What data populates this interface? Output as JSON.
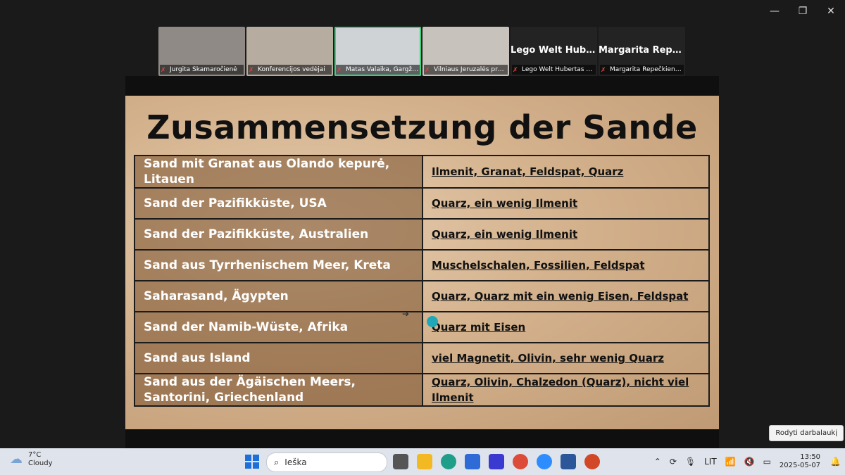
{
  "window": {
    "minimize": "—",
    "restore": "❐",
    "close": "✕"
  },
  "participants": [
    {
      "label": "Jurgita Skamaročienė",
      "bg": "#8f8a86",
      "active": false
    },
    {
      "label": "Konferencijos vedėjai",
      "bg": "#b7aca0",
      "active": false
    },
    {
      "label": "Matas Valaika, Gargždų \"K...",
      "bg": "#cfd3d6",
      "active": true
    },
    {
      "label": "Vilniaus Jeruzalės prog...",
      "bg": "#c7c2bb",
      "active": false
    },
    {
      "label": "Lego Welt Hubertas un...",
      "name": "Lego Welt Hube...",
      "bg": "#232323",
      "active": false
    },
    {
      "label": "Margarita Repečkienė, ...",
      "name": "Margarita Repe...",
      "bg": "#232323",
      "active": false
    }
  ],
  "slide": {
    "title": "Zusammensetzung der Sande",
    "rows": [
      {
        "name": "Sand mit Granat aus Olando kepurė, Litauen",
        "composition": "Ilmenit, Granat, Feldspat, Quarz"
      },
      {
        "name": "Sand der Pazifikküste, USA",
        "composition": "Quarz, ein wenig Ilmenit"
      },
      {
        "name": "Sand der Pazifikküste, Australien",
        "composition": "Quarz, ein wenig Ilmenit"
      },
      {
        "name": "Sand aus Tyrrhenischem Meer, Kreta",
        "composition": "Muschelschalen, Fossilien, Feldspat"
      },
      {
        "name": "Saharasand, Ägypten",
        "composition": "Quarz, Quarz mit ein wenig Eisen, Feldspat"
      },
      {
        "name": "Sand der Namib-Wüste, Afrika",
        "composition": "Quarz mit Eisen"
      },
      {
        "name": "Sand aus Island",
        "composition": "viel Magnetit, Olivin, sehr wenig Quarz"
      },
      {
        "name": "Sand aus der Ägäischen Meers, Santorini, Griechenland",
        "composition": "Quarz, Olivin, Chalzedon (Quarz), nicht viel Ilmenit"
      }
    ]
  },
  "tooltip": "Rodyti darbalaukį",
  "taskbar": {
    "weather_temp": "7°C",
    "weather_desc": "Cloudy",
    "search_text": "Ieška",
    "lang": "LIT",
    "time": "13:50",
    "date": "2025-05-07"
  }
}
